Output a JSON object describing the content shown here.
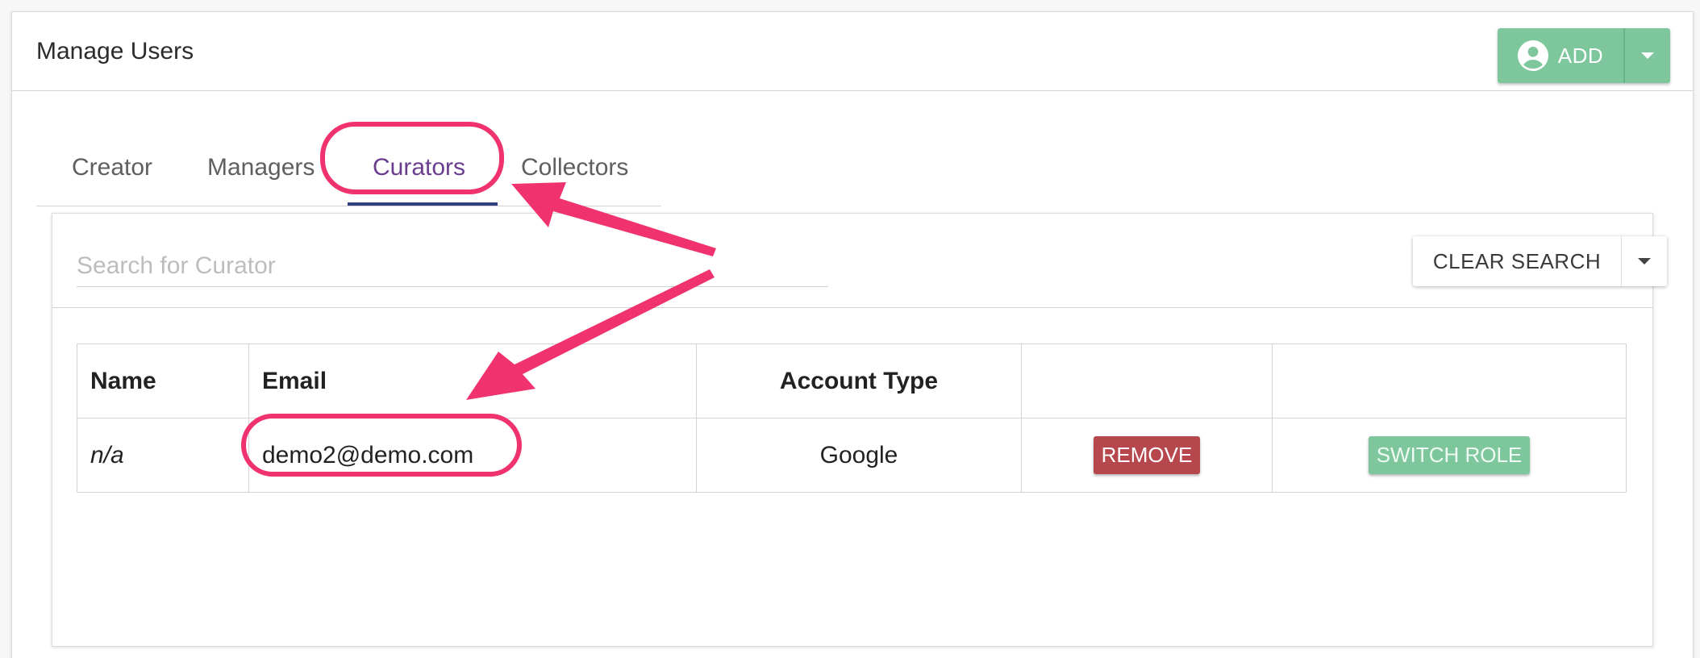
{
  "header": {
    "title": "Manage Users",
    "add_label": "ADD",
    "add_icon": "account-circle-icon"
  },
  "tabs": [
    {
      "label": "Creator",
      "active": false
    },
    {
      "label": "Managers",
      "active": false
    },
    {
      "label": "Curators",
      "active": true
    },
    {
      "label": "Collectors",
      "active": false
    }
  ],
  "search": {
    "placeholder": "Search for Curator",
    "value": "",
    "clear_label": "CLEAR SEARCH"
  },
  "table": {
    "columns": [
      "Name",
      "Email",
      "Account Type",
      "",
      ""
    ],
    "rows": [
      {
        "name": "n/a",
        "email": "demo2@demo.com",
        "account_type": "Google",
        "remove_label": "REMOVE",
        "switch_label": "SWITCH ROLE"
      }
    ]
  },
  "colors": {
    "accent_green": "#7ec79d",
    "remove_red": "#b5474d",
    "active_tab": "#6a3d8f",
    "annotation": "#f0336f"
  }
}
